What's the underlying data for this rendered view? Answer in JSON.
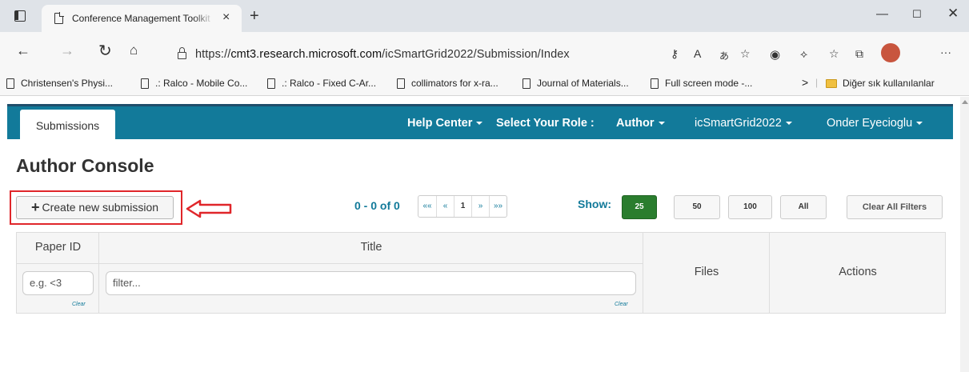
{
  "browser": {
    "tab_title": "Conference Management Toolkit",
    "tab_close": "×",
    "new_tab": "+",
    "url_prefix": "https://",
    "url_host": "cmt3.research.microsoft.com",
    "url_path": "/icSmartGrid2022/Submission/Index",
    "bookmarks": [
      "Christensen's Physi...",
      ".: Ralco - Mobile Co...",
      ".: Ralco - Fixed C-Ar...",
      "collimators for x-ra...",
      "Journal of Materials...",
      "Full screen mode -..."
    ],
    "bookmarks_overflow": ">",
    "other_bookmarks": "Diğer sık kullanılanlar",
    "icons": {
      "back": "back-arrow-icon",
      "forward": "forward-arrow-icon",
      "reload": "reload-icon",
      "home": "home-icon"
    }
  },
  "nav": {
    "submissions": "Submissions",
    "help_center": "Help Center",
    "select_role_label": "Select Your Role :",
    "role": "Author",
    "conference": "icSmartGrid2022",
    "user": "Onder Eyecioglu"
  },
  "console": {
    "title": "Author Console",
    "create_plus": "+",
    "create_label": "Create new submission"
  },
  "pager": {
    "count": "0 - 0 of 0",
    "first": "««",
    "prev": "«",
    "current": "1",
    "next": "»",
    "last": "»»",
    "show_label": "Show:",
    "sizes": [
      "25",
      "50",
      "100",
      "All"
    ],
    "active_size": "25",
    "clear_filters": "Clear All Filters"
  },
  "table": {
    "col_paper_id": "Paper ID",
    "col_title": "Title",
    "col_files": "Files",
    "col_actions": "Actions",
    "paper_id_placeholder": "e.g. <3",
    "title_placeholder": "filter...",
    "clear": "Clear"
  },
  "colors": {
    "navbar": "#127a9a",
    "accent_text": "#127a9a",
    "active_page_size": "#2a7d2e",
    "highlight": "#e0262a"
  }
}
